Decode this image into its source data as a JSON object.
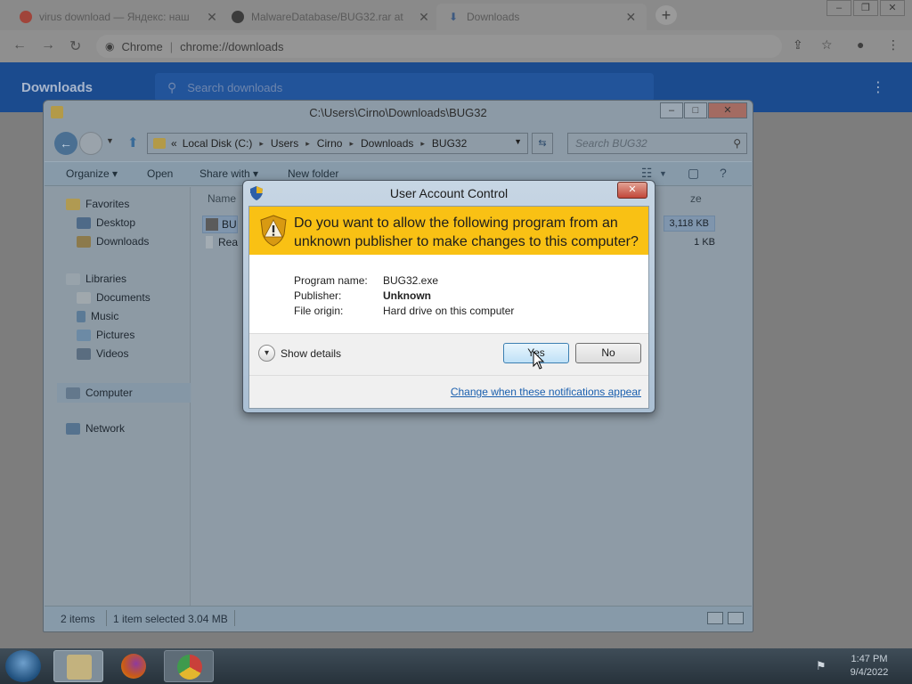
{
  "browser": {
    "tabs": [
      {
        "title": "virus download — Яндекс: наш",
        "active": false
      },
      {
        "title": "MalwareDatabase/BUG32.rar at",
        "active": false
      },
      {
        "title": "Downloads",
        "active": true
      }
    ],
    "new_tab": "+",
    "window_controls": {
      "minimize": "–",
      "restore": "❐",
      "close": "✕"
    },
    "omnibox": {
      "site": "Chrome",
      "url": "chrome://downloads"
    },
    "downloads_title": "Downloads",
    "search_placeholder": "Search downloads"
  },
  "explorer": {
    "title": "C:\\Users\\Cirno\\Downloads\\BUG32",
    "breadcrumb": [
      "Local Disk (C:)",
      "Users",
      "Cirno",
      "Downloads",
      "BUG32"
    ],
    "breadcrumb_prefix": "«",
    "search_placeholder": "Search BUG32",
    "commands": {
      "organize": "Organize ▾",
      "open": "Open",
      "share_with": "Share with ▾",
      "new_folder": "New folder"
    },
    "nav": {
      "favorites": "Favorites",
      "desktop": "Desktop",
      "downloads": "Downloads",
      "libraries": "Libraries",
      "documents": "Documents",
      "music": "Music",
      "pictures": "Pictures",
      "videos": "Videos",
      "computer": "Computer",
      "network": "Network"
    },
    "columns": {
      "name": "Name",
      "size": "ze"
    },
    "files": [
      {
        "name": "BU",
        "size": "3,118 KB",
        "selected": true
      },
      {
        "name": "Rea",
        "size": "1 KB",
        "selected": false
      }
    ],
    "status": {
      "count": "2 items",
      "selected": "1 item selected  3.04 MB"
    }
  },
  "uac": {
    "title": "User Account Control",
    "close_label": "✕",
    "question": "Do you want to allow the following program from an unknown publisher to make changes to this computer?",
    "program_label": "Program name:",
    "program_value": "BUG32.exe",
    "publisher_label": "Publisher:",
    "publisher_value": "Unknown",
    "origin_label": "File origin:",
    "origin_value": "Hard drive on this computer",
    "show_details": "Show details",
    "yes": "Yes",
    "no": "No",
    "link": "Change when these notifications appear"
  },
  "taskbar": {
    "time": "1:47 PM",
    "date": "9/4/2022"
  },
  "colors": {
    "uac_banner": "#f9c114",
    "chrome_header": "#1b4b8e",
    "link": "#1a5fae"
  }
}
